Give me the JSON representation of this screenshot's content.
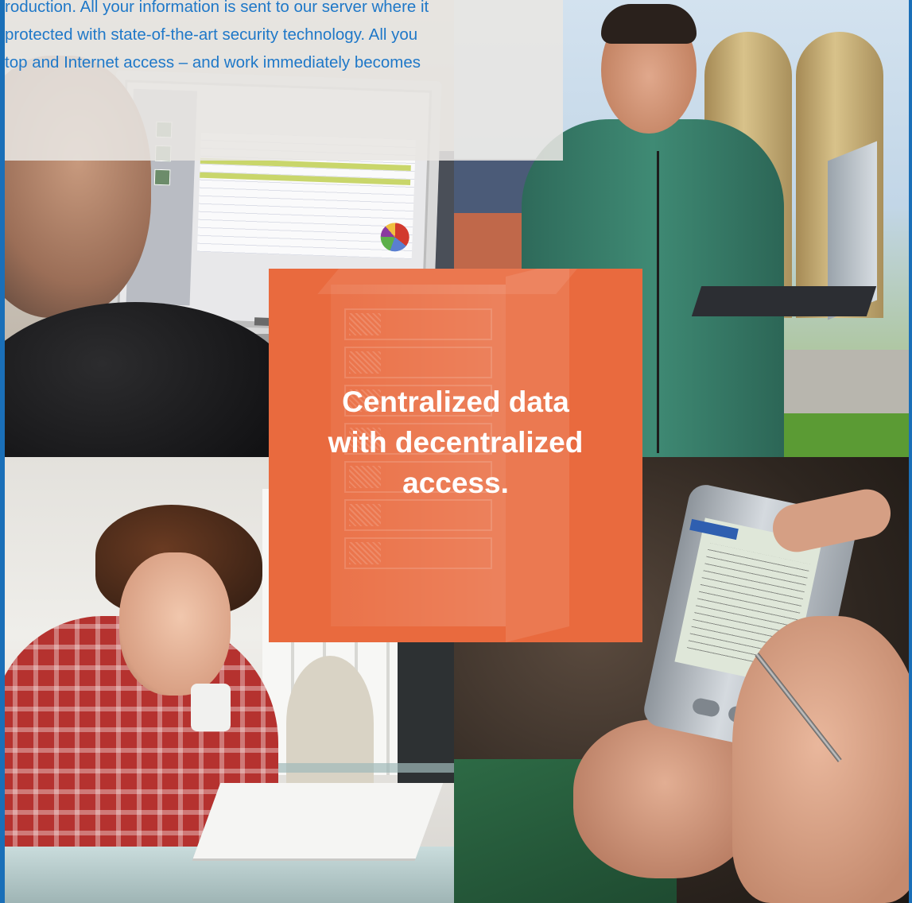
{
  "intro": {
    "lines": [
      "roduction. All your information is sent to our server where it",
      "protected with state-of-the-art security technology.  All you",
      "top and Internet access – and  work immediately becomes"
    ]
  },
  "headline": {
    "lines": [
      "Centralized data",
      "with decentralized",
      "access."
    ]
  },
  "colors": {
    "accent_orange": "#e96a3e",
    "text_blue": "#1f78c8",
    "frame_blue": "#1a6fb8"
  },
  "images": {
    "top_left": "person-at-monitor-photo",
    "top_right": "farmer-with-laptop-photo",
    "bottom_left": "student-with-laptop-photo",
    "bottom_right": "hands-with-pda-photo",
    "center": "server-tower-illustration"
  }
}
